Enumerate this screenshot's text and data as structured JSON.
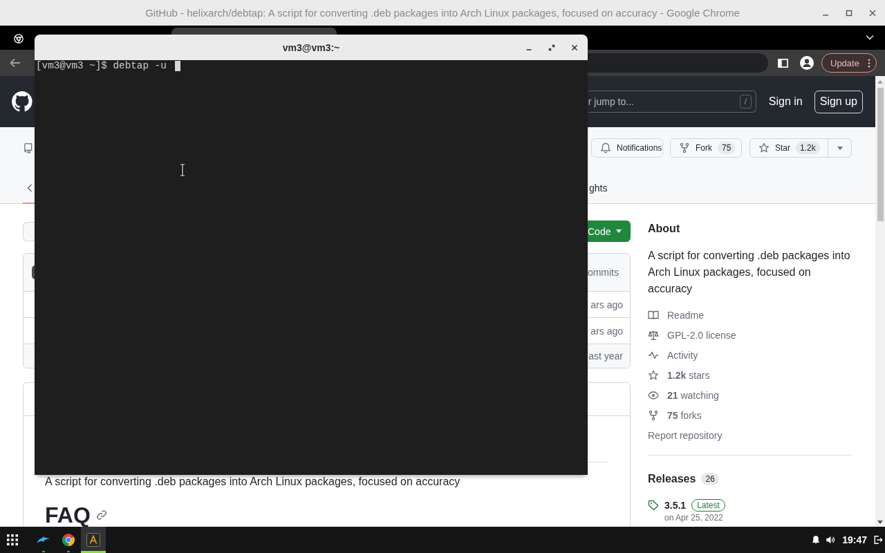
{
  "browser": {
    "title": "GitHub - helixarch/debtap: A script for converting .deb packages into Arch Linux packages, focused on accuracy - Google Chrome",
    "tabs": [
      {
        "selected": false
      },
      {
        "selected": true
      }
    ],
    "update_button": "Update"
  },
  "github_header": {
    "search": {
      "placeholder": "r jump to..."
    },
    "search_key": "/",
    "sign_in": "Sign in",
    "sign_up": "Sign up"
  },
  "repo_actions": [
    {
      "kind": "notifications",
      "label": "Notifications"
    },
    {
      "kind": "fork",
      "label": "Fork",
      "count": "75"
    },
    {
      "kind": "star",
      "label": "Star",
      "count": "1.2k"
    }
  ],
  "repo_nav": {
    "tab": "ghts"
  },
  "code_button": "Code",
  "file_list": {
    "header": "ommits",
    "rows": [
      "ars ago",
      "ars ago",
      "ast year"
    ]
  },
  "readme": {
    "description": "A script for converting .deb packages into Arch Linux packages, focused on accuracy",
    "heading": "FAQ"
  },
  "about": {
    "title": "About",
    "description": "A script for converting .deb packages into Arch Linux packages, focused on accuracy",
    "links": [
      {
        "kind": "readme",
        "text": "Readme"
      },
      {
        "kind": "license",
        "text": "GPL-2.0 license"
      },
      {
        "kind": "activity",
        "text": "Activity"
      },
      {
        "kind": "stars",
        "count": "1.2k",
        "text": "stars"
      },
      {
        "kind": "watching",
        "count": "21",
        "text": "watching"
      },
      {
        "kind": "forks",
        "count": "75",
        "text": "forks"
      }
    ],
    "report": "Report repository"
  },
  "releases": {
    "title": "Releases",
    "count": "26",
    "latest": {
      "version": "3.5.1",
      "badge": "Latest",
      "date": "on Apr 25, 2022"
    }
  },
  "terminal": {
    "title": "vm3@vm3:~",
    "lines": [
      "[vm3@vm3 ~]$ debtap -u"
    ]
  },
  "taskbar": {
    "apps": [
      {
        "kind": "files",
        "selected": false
      },
      {
        "kind": "browser",
        "selected": false
      },
      {
        "kind": "terminal",
        "selected": true
      }
    ],
    "clock": "19:47"
  }
}
